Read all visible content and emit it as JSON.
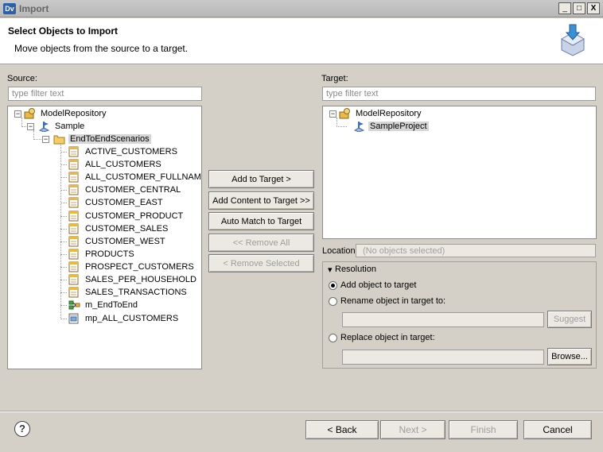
{
  "window": {
    "title": "Import",
    "app_icon_text": "Dv",
    "min_icon": "_",
    "max_icon": "□",
    "close_icon": "X"
  },
  "header": {
    "title": "Select Objects to Import",
    "description": "Move objects from the source to a target."
  },
  "source": {
    "label": "Source:",
    "filter_placeholder": "type filter text",
    "tree": {
      "root": "ModelRepository",
      "project": "Sample",
      "folder": "EndToEndScenarios",
      "items": [
        "ACTIVE_CUSTOMERS",
        "ALL_CUSTOMERS",
        "ALL_CUSTOMER_FULLNAME",
        "CUSTOMER_CENTRAL",
        "CUSTOMER_EAST",
        "CUSTOMER_PRODUCT",
        "CUSTOMER_SALES",
        "CUSTOMER_WEST",
        "PRODUCTS",
        "PROSPECT_CUSTOMERS",
        "SALES_PER_HOUSEHOLD",
        "SALES_TRANSACTIONS",
        "m_EndToEnd",
        "mp_ALL_CUSTOMERS"
      ]
    }
  },
  "target": {
    "label": "Target:",
    "filter_placeholder": "type filter text",
    "tree": {
      "root": "ModelRepository",
      "project": "SampleProject"
    }
  },
  "middle_buttons": {
    "add_to_target": "Add to Target >",
    "add_content": "Add Content to Target >>",
    "auto_match": "Auto Match to Target",
    "remove_all": "<< Remove All",
    "remove_selected": "< Remove Selected"
  },
  "location": {
    "label": "Location:",
    "value": "(No objects selected)"
  },
  "resolution": {
    "title": "Resolution",
    "toggle_icon": "▾",
    "option_add": "Add object to target",
    "option_rename": "Rename object in target to:",
    "option_replace": "Replace object in target:",
    "suggest": "Suggest",
    "browse": "Browse..."
  },
  "footer": {
    "help_icon": "?",
    "back": "< Back",
    "next": "Next >",
    "finish": "Finish",
    "cancel": "Cancel"
  }
}
